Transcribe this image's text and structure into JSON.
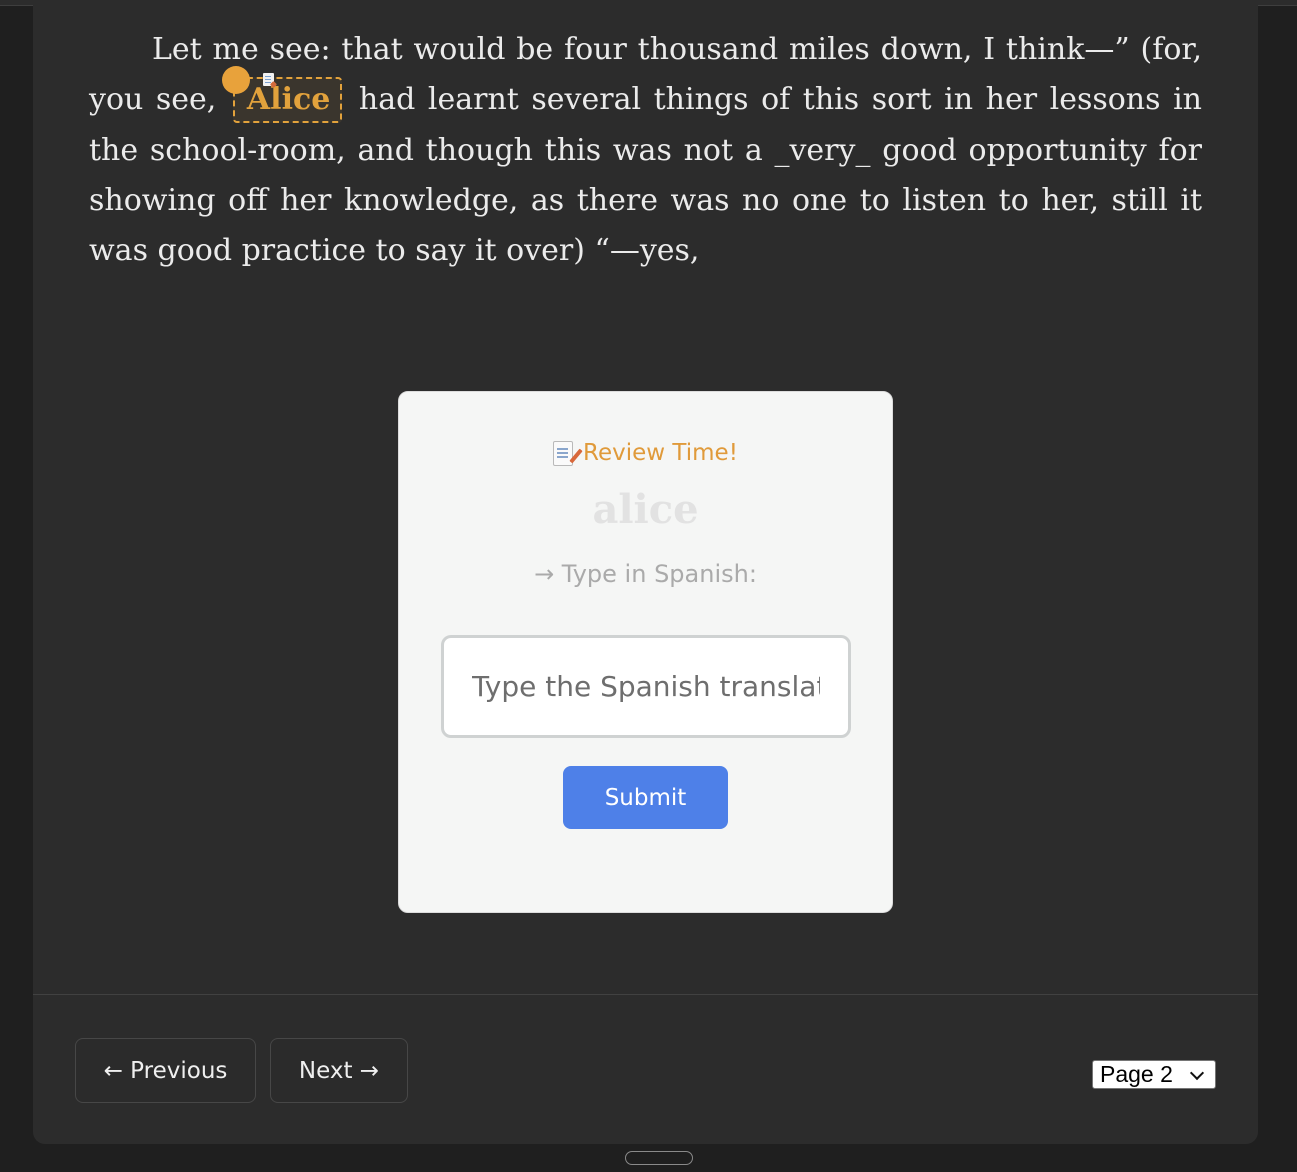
{
  "story": {
    "text_before": "Let me see: that would be four thousand miles down, I think—” (for, you see,",
    "highlighted_word": "Alice",
    "text_after": "had learnt several things of this sort in her lessons in the school-room, and though this was not a _very_ good opportunity for showing off her knowledge, as there was no one to listen to her, still it was good practice to say it over) “—yes,"
  },
  "review": {
    "title": "Review Time!",
    "word": "alice",
    "prompt": "→ Type in Spanish:",
    "input_placeholder": "Type the Spanish translation...",
    "input_value": "",
    "submit_label": "Submit"
  },
  "footer": {
    "previous_label": "← Previous",
    "next_label": "Next →",
    "page_selected": "Page 2"
  },
  "colors": {
    "background": "#2c2c2c",
    "highlight_accent": "#e2a23c",
    "submit_button": "#4e80e8",
    "card_background": "#f5f6f5"
  },
  "icons": {
    "highlight_marker": "orange-dot-icon",
    "review_title": "memo-icon",
    "page_select": "chevron-down-icon"
  }
}
